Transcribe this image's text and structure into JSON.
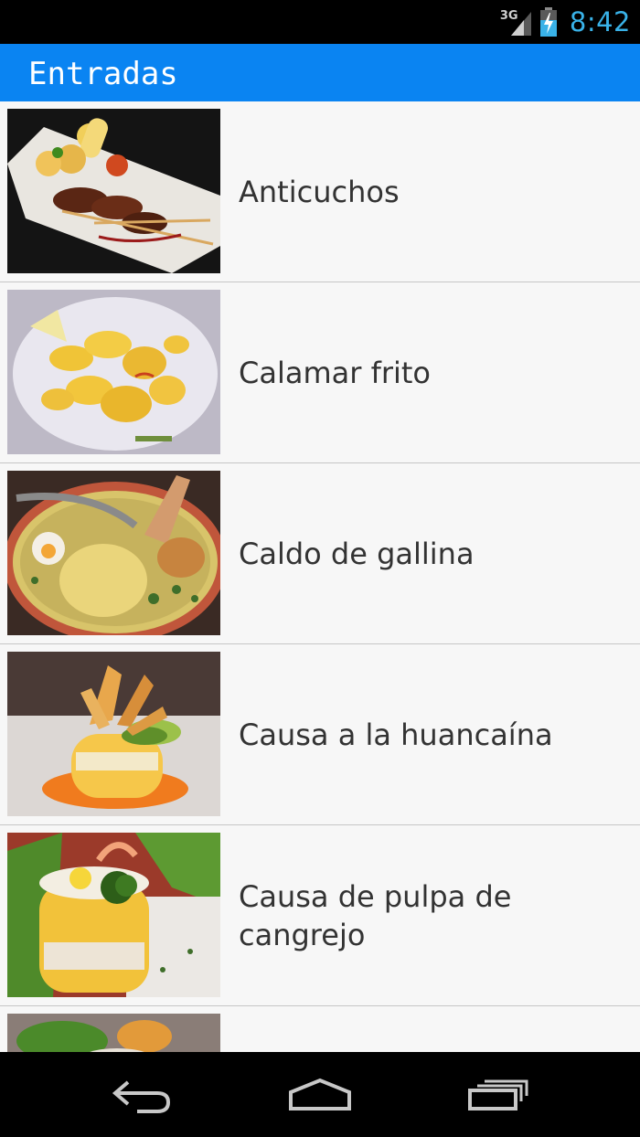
{
  "status_bar": {
    "network": "3G",
    "time": "8:42",
    "icons": [
      "signal-icon",
      "battery-charging-icon"
    ]
  },
  "action_bar": {
    "title": "Entradas"
  },
  "items": [
    {
      "label": "Anticuchos"
    },
    {
      "label": "Calamar frito"
    },
    {
      "label": "Caldo de gallina"
    },
    {
      "label": "Causa a la huancaína"
    },
    {
      "label": "Causa de  pulpa de cangrejo"
    },
    {
      "label": ""
    }
  ],
  "nav_bar": {
    "icons": [
      "back-icon",
      "home-icon",
      "recent-apps-icon"
    ]
  },
  "colors": {
    "action_bar": "#0a84f2",
    "clock": "#39b2e8",
    "list_background": "#f7f7f7"
  }
}
